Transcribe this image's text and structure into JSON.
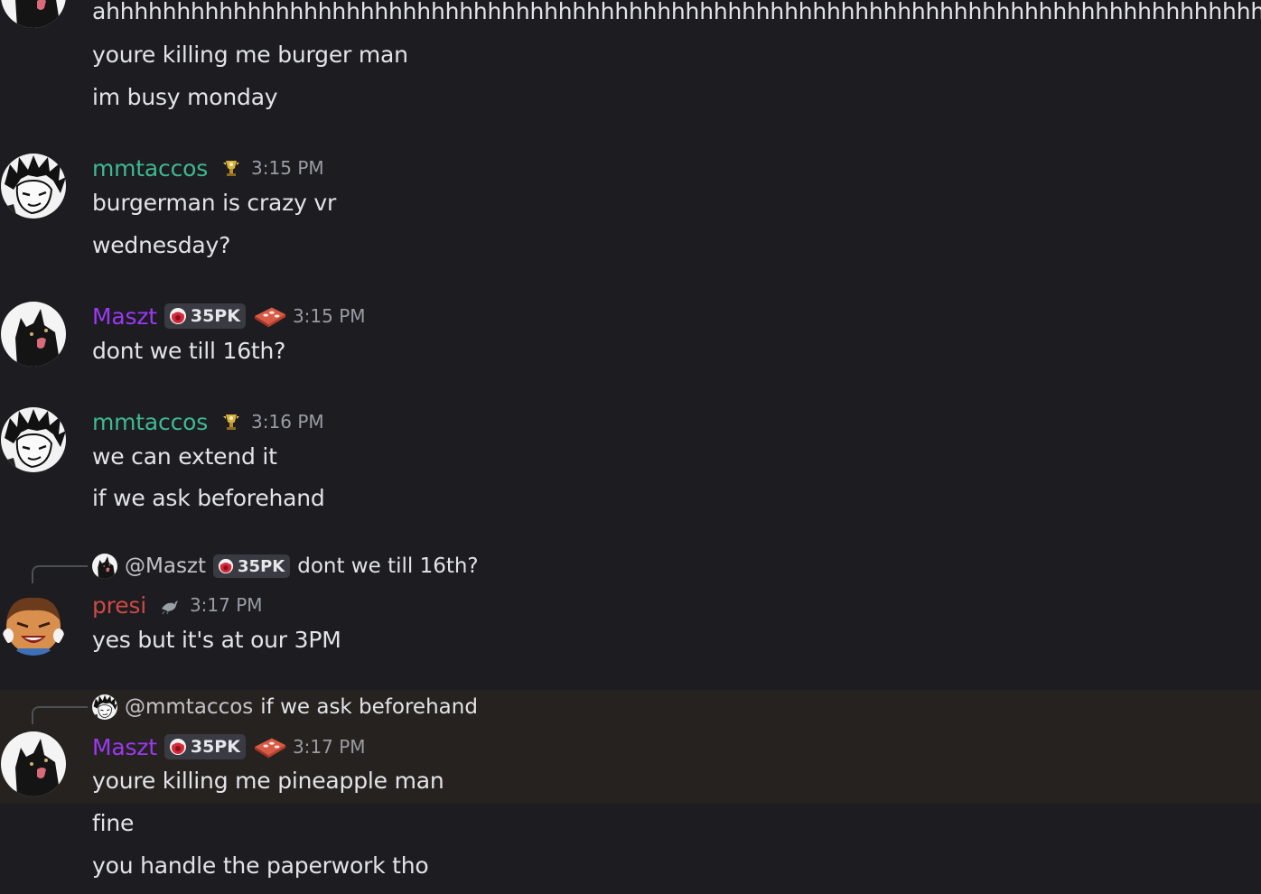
{
  "messages": {
    "prev": {
      "lines": [
        "ahhhhhhhhhhhhhhhhhhhhhhhhhhhhhhhhhhhhhhhhhhhhhhhhhhhhhhhhhhhhhhhhhhhhhhhhhhhhhhhhhhhhhhhh",
        "youre killing me burger man",
        "im busy monday"
      ]
    },
    "m1": {
      "author": "mmtaccos",
      "time": "3:15 PM",
      "lines": [
        "burgerman is crazy vr",
        "wednesday?"
      ]
    },
    "m2": {
      "author": "Maszt",
      "tag": "35PK",
      "time": "3:15 PM",
      "lines": [
        "dont we till 16th?"
      ]
    },
    "m3": {
      "author": "mmtaccos",
      "time": "3:16 PM",
      "lines": [
        "we can extend it",
        "if we ask beforehand"
      ]
    },
    "m4": {
      "reply": {
        "mention": "@Maszt",
        "tag": "35PK",
        "text": "dont we till 16th?"
      },
      "author": "presi",
      "time": "3:17 PM",
      "lines": [
        "yes but it's at our 3PM"
      ]
    },
    "m5": {
      "reply": {
        "mention": "@mmtaccos",
        "text": "if we ask beforehand"
      },
      "author": "Maszt",
      "tag": "35PK",
      "time": "3:17 PM",
      "lines": [
        "youre killing me pineapple man",
        "fine",
        "you handle the paperwork tho"
      ]
    }
  },
  "colors": {
    "background": "#1c1c21",
    "highlight": "#26221f",
    "mmtaccos": "#3fb98e",
    "maszt": "#9b39f2",
    "presi": "#cc4a45",
    "timestamp": "#9a9ca5"
  },
  "icons": {
    "role_mmtaccos": "trophy-sparkle-icon",
    "role_presi": "bird-icon",
    "maszt_decoration": "brick-icon",
    "tag_icon": "red-orb-icon"
  }
}
